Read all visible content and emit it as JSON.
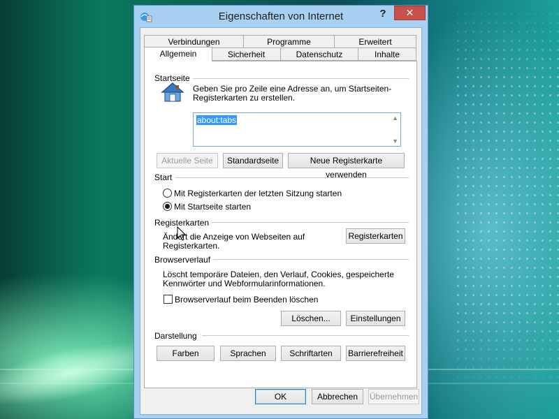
{
  "window": {
    "title": "Eigenschaften von Internet",
    "help_label": "?",
    "close_label": "✕"
  },
  "tabs": {
    "row1": [
      "Verbindungen",
      "Programme",
      "Erweitert"
    ],
    "row2": [
      "Allgemein",
      "Sicherheit",
      "Datenschutz",
      "Inhalte"
    ],
    "active": "Allgemein"
  },
  "startseite": {
    "label": "Startseite",
    "description_line1": "Geben Sie pro Zeile eine Adresse an, um Startseiten-",
    "description_line2": "Registerkarten zu erstellen.",
    "url_value": "about:tabs",
    "buttons": {
      "current": "Aktuelle Seite",
      "default": "Standardseite",
      "new_tab": "Neue Registerkarte verwenden"
    }
  },
  "start": {
    "label": "Start",
    "options": [
      {
        "label": "Mit Registerkarten der letzten Sitzung starten",
        "checked": false
      },
      {
        "label": "Mit Startseite starten",
        "checked": true
      }
    ]
  },
  "registerkarten": {
    "label": "Registerkarten",
    "description_line1": "Ändert die Anzeige von Webseiten auf",
    "description_line2": "Registerkarten.",
    "button": "Registerkarten"
  },
  "browserverlauf": {
    "label": "Browserverlauf",
    "description_line1": "Löscht temporäre Dateien, den Verlauf, Cookies, gespeicherte",
    "description_line2": "Kennwörter und Webformularinformationen.",
    "checkbox_label": "Browserverlauf beim Beenden löschen",
    "checkbox_checked": false,
    "delete_button": "Löschen...",
    "settings_button": "Einstellungen"
  },
  "darstellung": {
    "label": "Darstellung",
    "buttons": [
      "Farben",
      "Sprachen",
      "Schriftarten",
      "Barrierefreiheit"
    ]
  },
  "footer": {
    "ok": "OK",
    "cancel": "Abbrechen",
    "apply": "Übernehmen"
  },
  "colors": {
    "selection": "#3399ff",
    "window_frame": "#a8d0f2",
    "close_button": "#c7504a"
  }
}
